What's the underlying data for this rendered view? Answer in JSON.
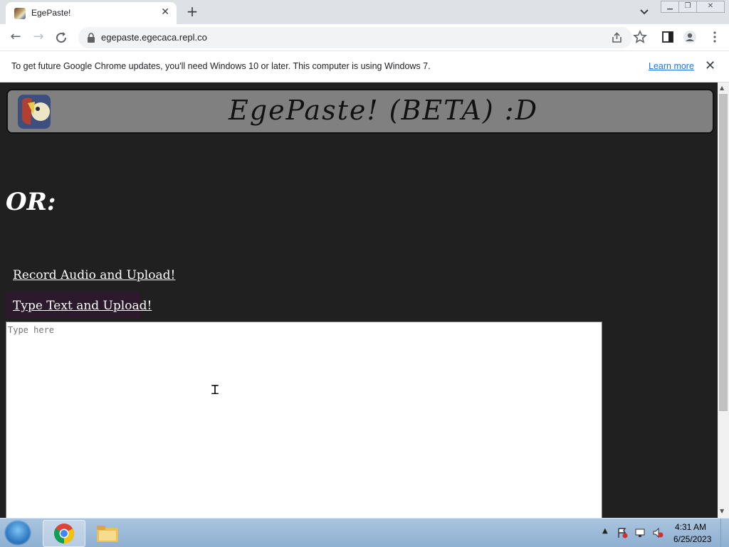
{
  "browser": {
    "tab_title": "EgePaste!",
    "url": "egepaste.egecaca.repl.co",
    "infobar_message": "To get future Google Chrome updates, you'll need Windows 10 or later. This computer is using Windows 7.",
    "infobar_link": "Learn more"
  },
  "page": {
    "site_title": "EgePaste! (BETA) :D",
    "or_heading": "OR:",
    "record_link": "Record Audio and Upload!",
    "type_link": "Type Text and Upload!",
    "textarea_placeholder": "Type here",
    "textarea_value": ""
  },
  "taskbar": {
    "time": "4:31 AM",
    "date": "6/25/2023"
  },
  "colors": {
    "page_background": "#202020",
    "header_background": "#808080",
    "type_link_highlight": "#2c1a2c",
    "link_color": "#ffffff"
  }
}
